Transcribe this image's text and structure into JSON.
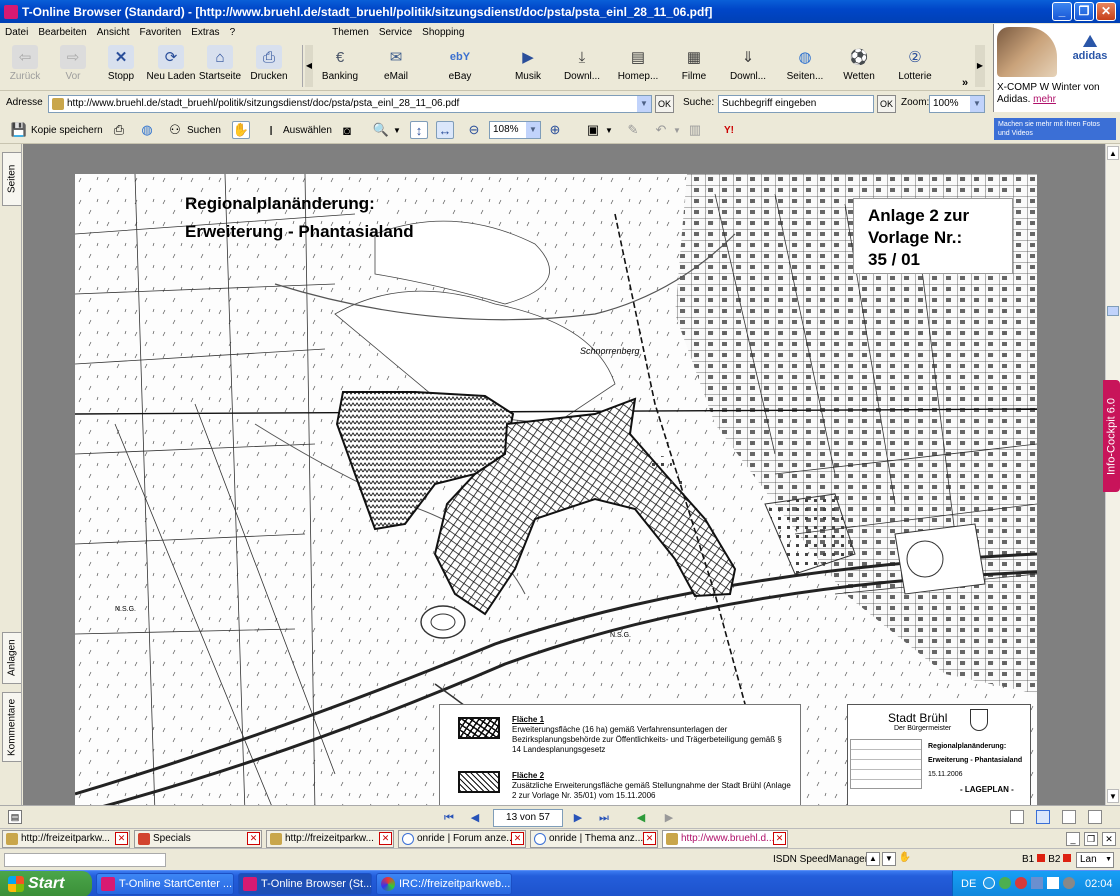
{
  "window": {
    "title": "T-Online Browser (Standard) - [http://www.bruehl.de/stadt_bruehl/politik/sitzungsdienst/doc/psta/psta_einl_28_11_06.pdf]"
  },
  "menu": {
    "items": [
      "Datei",
      "Bearbeiten",
      "Ansicht",
      "Favoriten",
      "Extras",
      "?"
    ],
    "right_items": [
      "Themen",
      "Service",
      "Shopping"
    ]
  },
  "toolbar": {
    "nav": [
      {
        "label": "Zurück",
        "icon": "back-arrow-icon",
        "disabled": true
      },
      {
        "label": "Vor",
        "icon": "forward-arrow-icon",
        "disabled": true
      },
      {
        "label": "Stopp",
        "icon": "stop-icon"
      },
      {
        "label": "Neu Laden",
        "icon": "reload-icon"
      },
      {
        "label": "Startseite",
        "icon": "home-icon"
      },
      {
        "label": "Drucken",
        "icon": "print-icon"
      }
    ],
    "services": [
      {
        "label": "Banking",
        "icon": "euro-icon"
      },
      {
        "label": "eMail",
        "icon": "mail-icon"
      },
      {
        "label": "eBay",
        "icon": "ebay-icon"
      },
      {
        "label": "Musik",
        "icon": "music-icon"
      },
      {
        "label": "Downl...",
        "icon": "download-icon"
      },
      {
        "label": "Homep...",
        "icon": "homepage-icon"
      },
      {
        "label": "Filme",
        "icon": "film-icon"
      },
      {
        "label": "Downl...",
        "icon": "download2-icon"
      },
      {
        "label": "Seiten...",
        "icon": "globe-icon"
      },
      {
        "label": "Wetten",
        "icon": "soccer-ball-icon"
      },
      {
        "label": "Lotterie",
        "icon": "lottery-icon"
      }
    ]
  },
  "ad": {
    "brand": "adidas",
    "text": "X-COMP W Winter von Adidas.",
    "link": "mehr"
  },
  "address": {
    "label": "Adresse",
    "url": "http://www.bruehl.de/stadt_bruehl/politik/sitzungsdienst/doc/psta/psta_einl_28_11_06.pdf",
    "ok": "OK",
    "search_label": "Suche:",
    "search_placeholder": "Suchbegriff eingeben",
    "zoom_label": "Zoom:",
    "zoom_value": "100%"
  },
  "pdf_toolbar": {
    "save_copy": "Kopie speichern",
    "search": "Suchen",
    "select": "Auswählen",
    "zoom_value": "108%",
    "promo": "Machen sie mehr mit ihren Fotos und Videos"
  },
  "side_tabs": {
    "top": "Seiten",
    "attachments": "Anlagen",
    "comments": "Kommentare",
    "info": "Info-Cockpit 6.0"
  },
  "map": {
    "title_line1": "Regionalplanänderung:",
    "title_line2": "Erweiterung - Phantasialand",
    "annex_line1": "Anlage 2 zur",
    "annex_line2": "Vorlage Nr.:",
    "annex_line3": "35 / 01",
    "place_label": "Schnorrenberg",
    "nsg_label_1": "N.S.G.",
    "nsg_label_2": "N.S.G.",
    "legend": {
      "item1_title": "Fläche 1",
      "item1_text": "Erweiterungsfläche (16 ha) gemäß Verfahrensunterlagen der Bezirksplanungsbehörde zur Öffentlichkeits- und Trägerbeteiligung gemäß § 14 Landesplanungsgesetz",
      "item2_title": "Fläche 2",
      "item2_text": "Zusätzliche Erweiterungsfläche gemäß Stellungnahme der Stadt Brühl (Anlage 2 zur Vorlage Nr. 35/01) vom 15.11.2006"
    },
    "titleblock": {
      "city": "Stadt Brühl",
      "office": "Der Bürgermeister",
      "subject_label": "Regionalplanänderung:",
      "subject": "Erweiterung - Phantasialand",
      "date": "15.11.2006",
      "plan": "- LAGEPLAN -"
    }
  },
  "pager": {
    "page_text": "13 von 57"
  },
  "browser_tabs": [
    {
      "label": "http://freizeitparkw..."
    },
    {
      "label": "Specials"
    },
    {
      "label": "http://freizeitparkw..."
    },
    {
      "label": "onride | Forum anze..."
    },
    {
      "label": "onride | Thema anz..."
    },
    {
      "label": "http://www.bruehl.d..."
    }
  ],
  "statusbar": {
    "speedmanager": "ISDN SpeedManager",
    "b1": "B1",
    "b2": "B2",
    "lan": "Lan"
  },
  "taskbar": {
    "start": "Start",
    "tasks": [
      {
        "label": "T-Online StartCenter ..."
      },
      {
        "label": "T-Online Browser (St..."
      },
      {
        "label": "IRC://freizeitparkweb..."
      }
    ],
    "lang": "DE",
    "time": "02:04"
  },
  "colors": {
    "xp_blue": "#0046c8",
    "info_magenta": "#c8145a",
    "start_green": "#3a8e38"
  }
}
